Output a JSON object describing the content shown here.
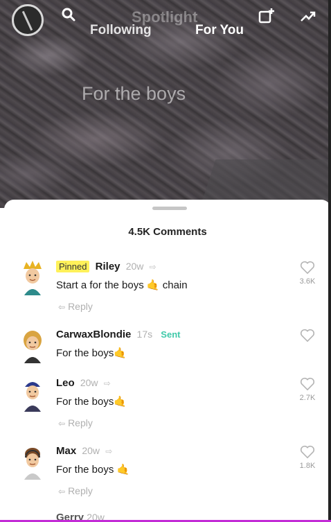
{
  "header": {
    "background_title": "Spotlight",
    "tabs": [
      {
        "label": "Following"
      },
      {
        "label": "For You"
      }
    ],
    "overlay_text": "For the boys"
  },
  "comments_sheet": {
    "title": "4.5K Comments",
    "comments": [
      {
        "badge": "Pinned",
        "name": "Riley",
        "time": "20w",
        "text": "Start a for the boys 🤙 chain",
        "reply_label": "Reply",
        "like_count": "3.6K"
      },
      {
        "name": "CarwaxBlondie",
        "time": "17s",
        "status": "Sent",
        "text": "For the boys🤙",
        "like_count": ""
      },
      {
        "name": "Leo",
        "time": "20w",
        "text": "For the boys🤙",
        "reply_label": "Reply",
        "like_count": "2.7K"
      },
      {
        "name": "Max",
        "time": "20w",
        "text": "For the boys 🤙",
        "reply_label": "Reply",
        "like_count": "1.8K"
      },
      {
        "name": "Gerry",
        "time": "20w"
      }
    ]
  },
  "colors": {
    "accent_sent": "#3fc9a9",
    "pinned_badge": "#fff15a",
    "bottom_bar": "#c32bd6"
  }
}
